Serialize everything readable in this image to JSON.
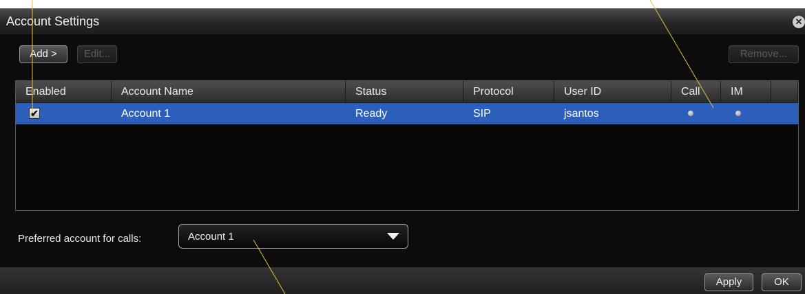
{
  "window": {
    "title": "Account Settings",
    "close_icon": "close-icon"
  },
  "toolbar": {
    "add_label": "Add >",
    "edit_label": "Edit...",
    "remove_label": "Remove..."
  },
  "table": {
    "columns": [
      "Enabled",
      "Account Name",
      "Status",
      "Protocol",
      "User ID",
      "Call",
      "IM"
    ],
    "rows": [
      {
        "enabled": true,
        "account_name": "Account 1",
        "status": "Ready",
        "protocol": "SIP",
        "user_id": "jsantos",
        "call": "grey-dot-icon",
        "im": "grey-dot-icon"
      }
    ]
  },
  "preferred": {
    "label": "Preferred account for calls:",
    "value": "Account 1"
  },
  "footer": {
    "apply_label": "Apply",
    "ok_label": "OK"
  },
  "colors": {
    "selection": "#2c5fbc",
    "background": "#0c0c0c",
    "callout_line": "#e8c23a"
  }
}
